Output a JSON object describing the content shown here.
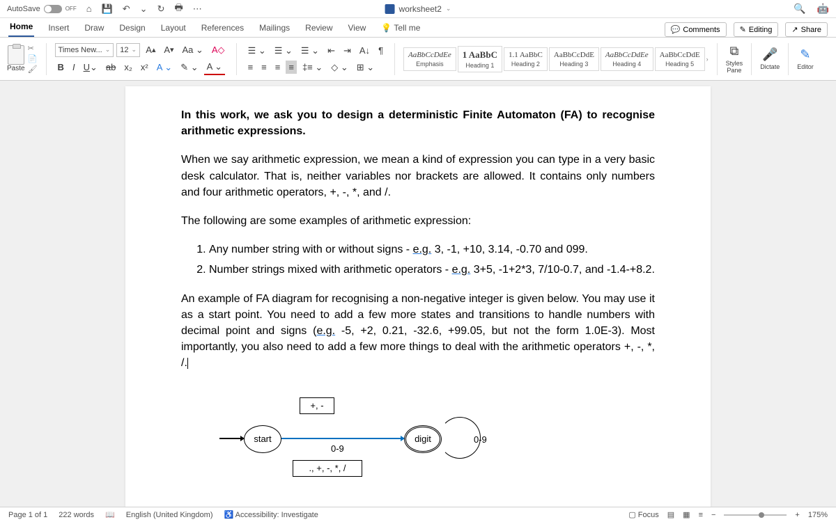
{
  "titlebar": {
    "autosave": "AutoSave",
    "off": "OFF",
    "doc_title": "worksheet2"
  },
  "tabs": {
    "home": "Home",
    "insert": "Insert",
    "draw": "Draw",
    "design": "Design",
    "layout": "Layout",
    "references": "References",
    "mailings": "Mailings",
    "review": "Review",
    "view": "View",
    "tellme": "Tell me",
    "comments": "Comments",
    "editing": "Editing",
    "share": "Share"
  },
  "ribbon": {
    "paste": "Paste",
    "font_name": "Times New...",
    "font_size": "12",
    "styles": [
      {
        "sample": "AaBbCcDdEe",
        "label": "Emphasis"
      },
      {
        "sample": "1 AaBbC",
        "label": "Heading 1"
      },
      {
        "sample": "1.1 AaBbC",
        "label": "Heading 2"
      },
      {
        "sample": "AaBbCcDdE",
        "label": "Heading 3"
      },
      {
        "sample": "AaBbCcDdEe",
        "label": "Heading 4"
      },
      {
        "sample": "AaBbCcDdE",
        "label": "Heading 5"
      }
    ],
    "styles_pane": "Styles\nPane",
    "dictate": "Dictate",
    "editor_btn": "Editor"
  },
  "document": {
    "p1": "In this work, we ask you to design a deterministic Finite Automaton (FA) to recognise arithmetic expressions.",
    "p2": "When we say arithmetic expression, we mean a kind of expression you can type in a very basic desk calculator. That is, neither variables nor brackets are allowed. It contains only numbers and four arithmetic operators, +, -, *, and /.",
    "p3": "The following are some examples of arithmetic expression:",
    "li1a": "Any number string with or without signs - ",
    "li1eg": "e.g.",
    "li1b": " 3, -1, +10, 3.14, -0.70 and 099.",
    "li2a": "Number strings mixed with arithmetic operators - ",
    "li2eg": "e.g.",
    "li2b": " 3+5, -1+2*3, 7/10-0.7, and -1.4-+8.2.",
    "p4a": "An example of FA diagram for recognising a non-negative integer is given below. You may use it as a start point. You need to add a few more states and transitions to handle numbers with decimal point and signs (",
    "p4eg": "e.g.",
    "p4b": " -5, +2, 0.21, -32.6, +99.05, but not the form 1.0E-3). Most importantly, you also need to add a few more things to deal with the arithmetic operators +, -, *, /.",
    "fa": {
      "start": "start",
      "digit": "digit",
      "box_top": "+, -",
      "box_bot": "., +, -, *, /",
      "mid": "0-9",
      "loop": "0-9"
    }
  },
  "statusbar": {
    "page": "Page 1 of 1",
    "words": "222 words",
    "lang": "English (United Kingdom)",
    "access": "Accessibility: Investigate",
    "focus": "Focus",
    "zoom": "175%"
  }
}
